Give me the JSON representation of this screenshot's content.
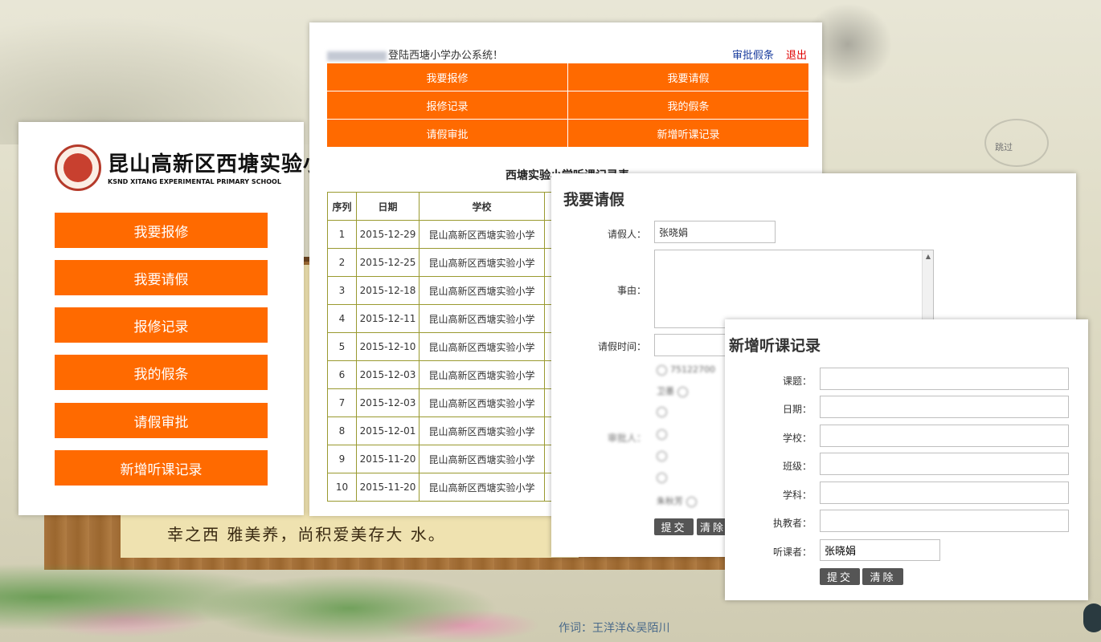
{
  "background": {
    "skip_text": "跳过",
    "poem_line": "幸之西   雅美养，尚积爱美存大   水。",
    "credit": "作词：王洋洋&吴陌川"
  },
  "sidebar": {
    "logo_cn": "昆山高新区西塘实验小学",
    "logo_en": "KSND XITANG EXPERIMENTAL PRIMARY SCHOOL",
    "buttons": [
      "我要报修",
      "我要请假",
      "报修记录",
      "我的假条",
      "请假审批",
      "新增听课记录"
    ]
  },
  "header": {
    "welcome_suffix": "登陆西塘小学办公系统！",
    "approve_link": "审批假条",
    "logout_link": "退出",
    "approve_color": "#1a3d9e",
    "logout_color": "#e00000"
  },
  "nav": {
    "rows": [
      [
        "我要报修",
        "我要请假"
      ],
      [
        "报修记录",
        "我的假条"
      ],
      [
        "请假审批",
        "新增听课记录"
      ]
    ],
    "accent": "#ff6a00"
  },
  "records": {
    "title": "西塘实验小学听课记录表",
    "headers": [
      "序列",
      "日期",
      "学校"
    ],
    "rows": [
      [
        "1",
        "2015-12-29",
        "昆山高新区西塘实验小学"
      ],
      [
        "2",
        "2015-12-25",
        "昆山高新区西塘实验小学"
      ],
      [
        "3",
        "2015-12-18",
        "昆山高新区西塘实验小学"
      ],
      [
        "4",
        "2015-12-11",
        "昆山高新区西塘实验小学"
      ],
      [
        "5",
        "2015-12-10",
        "昆山高新区西塘实验小学"
      ],
      [
        "6",
        "2015-12-03",
        "昆山高新区西塘实验小学"
      ],
      [
        "7",
        "2015-12-03",
        "昆山高新区西塘实验小学"
      ],
      [
        "8",
        "2015-12-01",
        "昆山高新区西塘实验小学"
      ],
      [
        "9",
        "2015-11-20",
        "昆山高新区西塘实验小学"
      ],
      [
        "10",
        "2015-11-20",
        "昆山高新区西塘实验小学"
      ]
    ]
  },
  "leave_form": {
    "title": "我要请假",
    "applicant_label": "请假人：",
    "applicant_value": "张晓娟",
    "reason_label": "事由：",
    "time_label": "请假时间：",
    "approver_label": "审批人：",
    "approver_first": "75122700",
    "approver_row2": "卫墨",
    "approver_last": "朱秋芳",
    "submit": "提交",
    "clear": "清除"
  },
  "lecture_form": {
    "title": "新增听课记录",
    "fields": [
      {
        "label": "课题：",
        "value": ""
      },
      {
        "label": "日期：",
        "value": ""
      },
      {
        "label": "学校：",
        "value": ""
      },
      {
        "label": "班级：",
        "value": ""
      },
      {
        "label": "学科：",
        "value": ""
      },
      {
        "label": "执教者：",
        "value": ""
      }
    ],
    "listener_label": "听课者：",
    "listener_value": "张晓娟",
    "submit": "提交",
    "clear": "清除"
  }
}
